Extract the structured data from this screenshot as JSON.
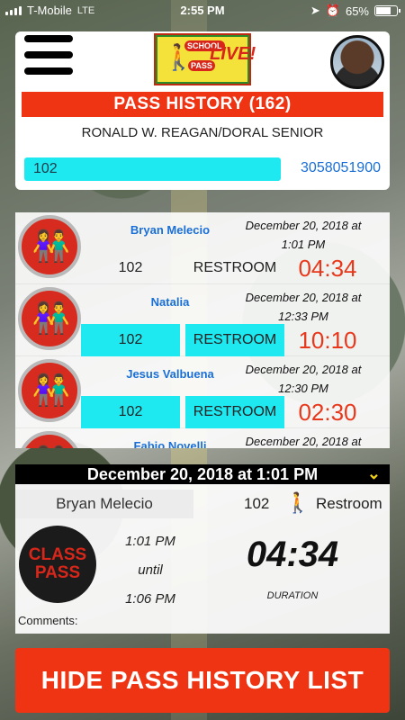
{
  "status_bar": {
    "carrier": "T-Mobile",
    "network": "LTE",
    "time": "2:55 PM",
    "battery": "65%"
  },
  "header": {
    "logo": {
      "school": "SCHOOL",
      "pass": "PASS",
      "live": "LIVE!"
    },
    "title": "PASS HISTORY (162)",
    "school_name": "RONALD W. REAGAN/DORAL SENIOR",
    "search": {
      "value": "102"
    },
    "phone": "3058051900"
  },
  "history": [
    {
      "name": "Bryan Melecio",
      "date_line1": "December 20, 2018 at",
      "date_line2": "1:01 PM",
      "room": "102",
      "reason": "RESTROOM",
      "duration": "04:34",
      "highlighted": false
    },
    {
      "name": "Natalia",
      "date_line1": "December 20, 2018 at",
      "date_line2": "12:33 PM",
      "room": "102",
      "reason": "RESTROOM",
      "duration": "10:10",
      "highlighted": true
    },
    {
      "name": "Jesus Valbuena",
      "date_line1": "December 20, 2018 at",
      "date_line2": "12:30 PM",
      "room": "102",
      "reason": "RESTROOM",
      "duration": "02:30",
      "highlighted": true
    },
    {
      "name": "Fabio Novelli",
      "date_line1": "December 20, 2018 at",
      "date_line2": "",
      "room": "",
      "reason": "",
      "duration": "",
      "highlighted": false
    }
  ],
  "detail": {
    "header": "December 20, 2018 at 1:01 PM",
    "student": "Bryan Melecio",
    "room": "102",
    "reason": "Restroom",
    "class_pass_line1": "CLASS",
    "class_pass_line2": "PASS",
    "start": "1:01 PM",
    "until": "until",
    "end": "1:06 PM",
    "duration": "04:34",
    "duration_label": "DURATION",
    "comments_label": "Comments:"
  },
  "hide_button": "HIDE PASS HISTORY LIST",
  "colors": {
    "accent_red": "#ef3414",
    "cyan": "#1ee8f0",
    "link_blue": "#1a6fd6"
  }
}
